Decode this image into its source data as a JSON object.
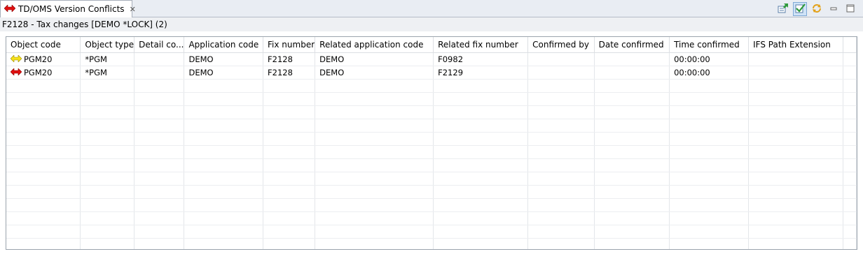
{
  "view": {
    "tab_title": "TD/OMS Version Conflicts",
    "tab_icon": "red-double-arrow-icon",
    "close_glyph": "✕",
    "toolbar_icons": [
      "export-icon",
      "confirm-check-icon",
      "refresh-sync-icon",
      "minimize-icon",
      "maximize-icon"
    ]
  },
  "subtitle": "F2128 - Tax changes [DEMO *LOCK] (2)",
  "table": {
    "columns": [
      "Object code",
      "Object type",
      "Detail co...",
      "Application code",
      "Fix number",
      "Related application code",
      "Related fix number",
      "Confirmed by",
      "Date confirmed",
      "Time confirmed",
      "IFS Path Extension",
      ""
    ],
    "rows": [
      {
        "icon": "yellow-double-arrow-icon",
        "cells": [
          "PGM20",
          "*PGM",
          "",
          "DEMO",
          "F2128",
          "DEMO",
          "F0982",
          "",
          "",
          "00:00:00",
          "",
          ""
        ]
      },
      {
        "icon": "red-double-arrow-icon",
        "cells": [
          "PGM20",
          "*PGM",
          "",
          "DEMO",
          "F2128",
          "DEMO",
          "F2129",
          "",
          "",
          "00:00:00",
          "",
          ""
        ]
      }
    ]
  },
  "colors": {
    "yellow_arrow": "#f5e01a",
    "red_arrow": "#e01010",
    "accent": "#7ea9d6"
  }
}
